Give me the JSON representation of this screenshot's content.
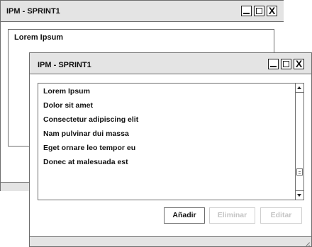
{
  "back_window": {
    "title": "IPM - SPRINT1",
    "panel_label": "Lorem Ipsum"
  },
  "front_window": {
    "title": "IPM - SPRINT1",
    "list_items": [
      "Lorem Ipsum",
      "Dolor sit amet",
      "Consectetur adipiscing elit",
      "Nam pulvinar dui massa",
      "Eget ornare leo tempor eu",
      "Donec at malesuada est"
    ],
    "buttons": {
      "add": "Añadir",
      "remove": "Eliminar",
      "edit": "Editar"
    },
    "close_glyph": "X"
  },
  "colors": {
    "titlebar_bg": "#e4e4e4",
    "border": "#6d6d6d",
    "disabled_text": "#c4c4c4"
  },
  "icons": [
    "minimize-icon",
    "maximize-icon",
    "close-icon",
    "scroll-up-icon",
    "scroll-down-icon",
    "resize-grip-icon"
  ]
}
